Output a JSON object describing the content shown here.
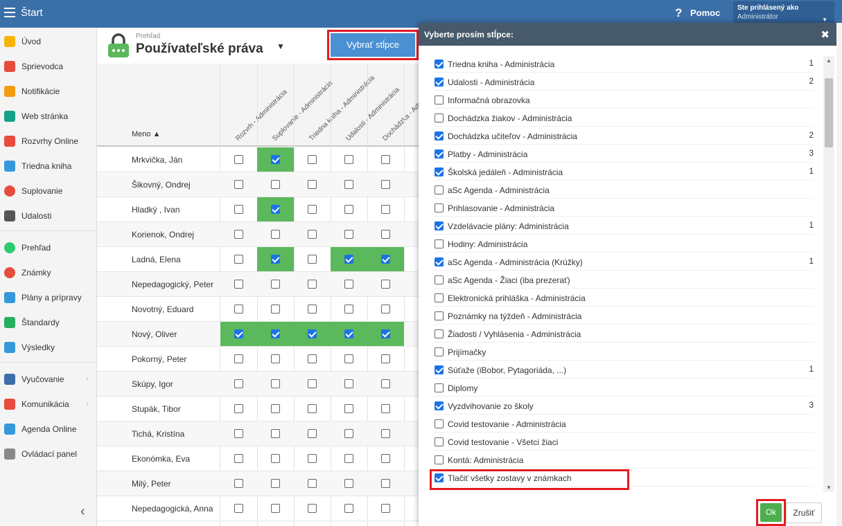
{
  "topbar": {
    "title": "Štart",
    "help_icon": "?",
    "help_label": "Pomoc",
    "user_line1": "Ste prihlásený ako",
    "user_line2": "Administrátor",
    "user_caret": "▼"
  },
  "sidebar": {
    "items": [
      {
        "label": "Úvod",
        "icon": "star-icon",
        "color": "#f4b400"
      },
      {
        "label": "Sprievodca",
        "icon": "magic-wand-icon",
        "color": "#e74c3c"
      },
      {
        "label": "Notifikácie",
        "icon": "envelope-icon",
        "color": "#f39c12"
      },
      {
        "label": "Web stránka",
        "icon": "home-icon",
        "color": "#16a085"
      },
      {
        "label": "Rozvrhy Online",
        "icon": "timetable-icon",
        "color": "#e74c3c"
      },
      {
        "label": "Triedna kniha",
        "icon": "book-icon",
        "color": "#3498db"
      },
      {
        "label": "Suplovanie",
        "icon": "person-icon",
        "color": "#e74c3c"
      },
      {
        "label": "Udalosti",
        "icon": "calendar-icon",
        "color": "#555555"
      },
      {
        "label": "Prehľad",
        "icon": "check-circle-icon",
        "color": "#2ecc71"
      },
      {
        "label": "Známky",
        "icon": "gauge-icon",
        "color": "#e74c3c"
      },
      {
        "label": "Plány a prípravy",
        "icon": "briefcase-icon",
        "color": "#3498db"
      },
      {
        "label": "Štandardy",
        "icon": "shield-icon",
        "color": "#27ae60"
      },
      {
        "label": "Výsledky",
        "icon": "bar-chart-icon",
        "color": "#3498db"
      },
      {
        "label": "Vyučovanie",
        "icon": "open-book-icon",
        "color": "#3a6fa8",
        "chevron": "›"
      },
      {
        "label": "Komunikácia",
        "icon": "chat-icon",
        "color": "#e74c3c",
        "chevron": "›"
      },
      {
        "label": "Agenda Online",
        "icon": "pencil-icon",
        "color": "#3498db"
      },
      {
        "label": "Ovládací panel",
        "icon": "gear-icon",
        "color": "#888888"
      }
    ],
    "collapse_icon": "‹"
  },
  "header": {
    "breadcrumb": "Prehľad",
    "title": "Používateľské práva",
    "caret": "▼",
    "select_columns_button": "Vybrať stĺpce"
  },
  "table": {
    "name_header": "Meno ▲",
    "columns": [
      "Rozvrh - Administrácia",
      "Suplovanie - Administrácia",
      "Triedna kniha - Administrácia",
      "Udalosti - Administrácia",
      "Dochádzka - Admin..."
    ],
    "rows": [
      {
        "name": "Mrkvička, Ján",
        "checks": [
          false,
          true,
          false,
          false,
          false
        ]
      },
      {
        "name": "Šikovný, Ondrej",
        "checks": [
          false,
          false,
          false,
          false,
          false
        ]
      },
      {
        "name": "Hladký , Ivan",
        "checks": [
          false,
          true,
          false,
          false,
          false
        ]
      },
      {
        "name": "Korienok, Ondrej",
        "checks": [
          false,
          false,
          false,
          false,
          false
        ]
      },
      {
        "name": "Ladná, Elena",
        "checks": [
          false,
          true,
          false,
          true,
          true
        ]
      },
      {
        "name": "Nepedagogický, Peter",
        "checks": [
          false,
          false,
          false,
          false,
          false
        ]
      },
      {
        "name": "Novotný, Eduard",
        "checks": [
          false,
          false,
          false,
          false,
          false
        ]
      },
      {
        "name": "Nový, Oliver",
        "checks": [
          true,
          true,
          true,
          true,
          true
        ]
      },
      {
        "name": "Pokorný, Peter",
        "checks": [
          false,
          false,
          false,
          false,
          false
        ]
      },
      {
        "name": "Skúpy, Igor",
        "checks": [
          false,
          false,
          false,
          false,
          false
        ]
      },
      {
        "name": "Stupák, Tibor",
        "checks": [
          false,
          false,
          false,
          false,
          false
        ]
      },
      {
        "name": "Tichá, Kristína",
        "checks": [
          false,
          false,
          false,
          false,
          false
        ]
      },
      {
        "name": "Ekonómka, Eva",
        "checks": [
          false,
          false,
          false,
          false,
          false
        ]
      },
      {
        "name": "Milý, Peter",
        "checks": [
          false,
          false,
          false,
          false,
          false
        ]
      },
      {
        "name": "Nepedagogická, Anna",
        "checks": [
          false,
          false,
          false,
          false,
          false
        ]
      }
    ]
  },
  "dialog": {
    "title": "Vyberte prosím stĺpce:",
    "close_icon": "✖",
    "options": [
      {
        "label": "Triedna kniha - Administrácia",
        "checked": true,
        "count": "1"
      },
      {
        "label": "Udalosti - Administrácia",
        "checked": true,
        "count": "2"
      },
      {
        "label": "Informačná obrazovka",
        "checked": false,
        "count": ""
      },
      {
        "label": "Dochádzka žiakov - Administrácia",
        "checked": false,
        "count": ""
      },
      {
        "label": "Dochádzka učiteľov - Administrácia",
        "checked": true,
        "count": "2"
      },
      {
        "label": "Platby - Administrácia",
        "checked": true,
        "count": "3"
      },
      {
        "label": "Školská jedáleň - Administrácia",
        "checked": true,
        "count": "1"
      },
      {
        "label": "aSc Agenda - Administrácia",
        "checked": false,
        "count": ""
      },
      {
        "label": "Prihlasovanie - Administrácia",
        "checked": false,
        "count": ""
      },
      {
        "label": "Vzdelávacie plány: Administrácia",
        "checked": true,
        "count": "1"
      },
      {
        "label": "Hodiny: Administrácia",
        "checked": false,
        "count": ""
      },
      {
        "label": "aSc Agenda - Administrácia (Krúžky)",
        "checked": true,
        "count": "1"
      },
      {
        "label": "aSc Agenda - Žiaci (iba prezerať)",
        "checked": false,
        "count": ""
      },
      {
        "label": "Elektronická prihláška - Administrácia",
        "checked": false,
        "count": ""
      },
      {
        "label": "Poznámky na týždeň - Administrácia",
        "checked": false,
        "count": ""
      },
      {
        "label": "Žiadosti / Vyhlásenia - Administrácia",
        "checked": false,
        "count": ""
      },
      {
        "label": "Prijímačky",
        "checked": false,
        "count": ""
      },
      {
        "label": "Súťaže (iBobor, Pytagoriáda, ...)",
        "checked": true,
        "count": "1"
      },
      {
        "label": "Diplomy",
        "checked": false,
        "count": ""
      },
      {
        "label": "Vyzdvihovanie zo školy",
        "checked": true,
        "count": "3"
      },
      {
        "label": "Covid testovanie - Administrácia",
        "checked": false,
        "count": ""
      },
      {
        "label": "Covid testovanie - Všetci žiaci",
        "checked": false,
        "count": ""
      },
      {
        "label": "Kontá: Administrácia",
        "checked": false,
        "count": ""
      },
      {
        "label": "Tlačiť všetky zostavy v známkach",
        "checked": true,
        "count": ""
      }
    ],
    "ok_button": "Ok",
    "cancel_button": "Zrušiť"
  },
  "colors": {
    "topbar": "#3a6fa8",
    "checked_cell": "#5cb85c",
    "highlight": "#e31b23",
    "checkbox": "#1a73e8"
  }
}
